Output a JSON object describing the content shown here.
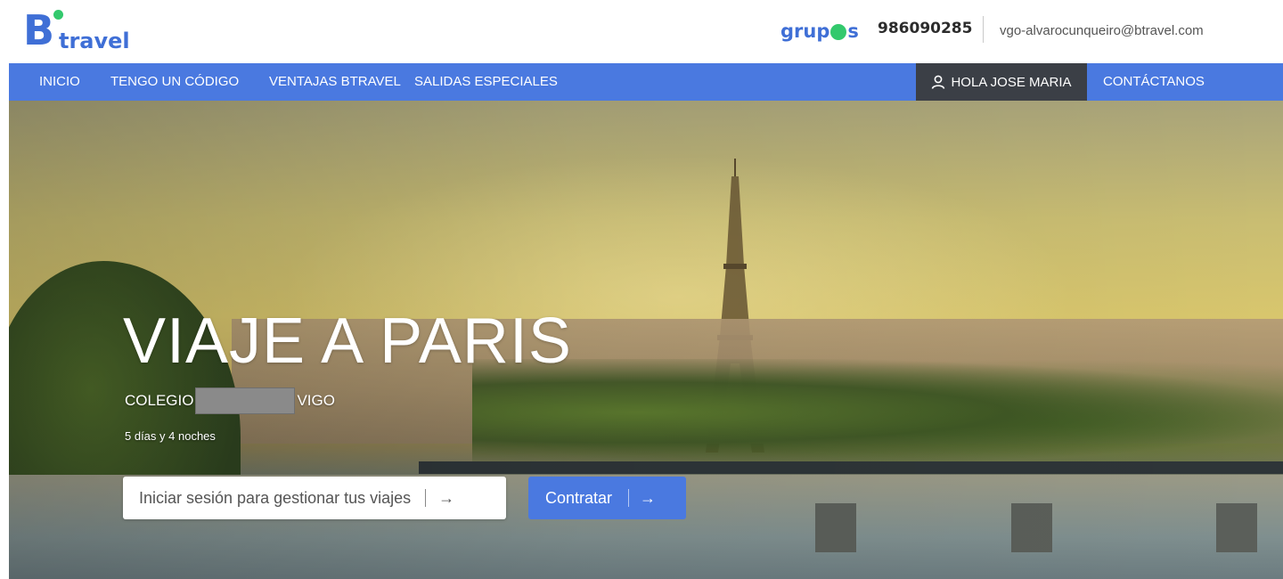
{
  "brand": {
    "logo_b": "B",
    "logo_travel": "travel"
  },
  "header": {
    "grupos_left": "grup",
    "grupos_right": "s",
    "phone": "986090285",
    "email": "vgo-alvarocunqueiro@btravel.com"
  },
  "nav": {
    "items": [
      {
        "label": "INICIO"
      },
      {
        "label": "TENGO UN CÓDIGO"
      },
      {
        "label": "VENTAJAS BTRAVEL"
      },
      {
        "label": "SALIDAS ESPECIALES"
      }
    ],
    "user": "HOLA JOSE MARIA",
    "contact": "CONTÁCTANOS"
  },
  "hero": {
    "title": "VIAJE A PARIS",
    "subtitle_prefix": "COLEGIO",
    "subtitle_suffix": "VIGO",
    "duration": "5 días y 4 noches",
    "login_label": "Iniciar sesión para gestionar tus viajes",
    "contratar_label": "Contratar",
    "arrow": "→"
  },
  "colors": {
    "brand_blue": "#4a79e0",
    "brand_green": "#33c96d",
    "user_bg": "#3b3f46"
  },
  "icons": {
    "user": "user-icon",
    "arrow": "arrow-right-icon"
  }
}
